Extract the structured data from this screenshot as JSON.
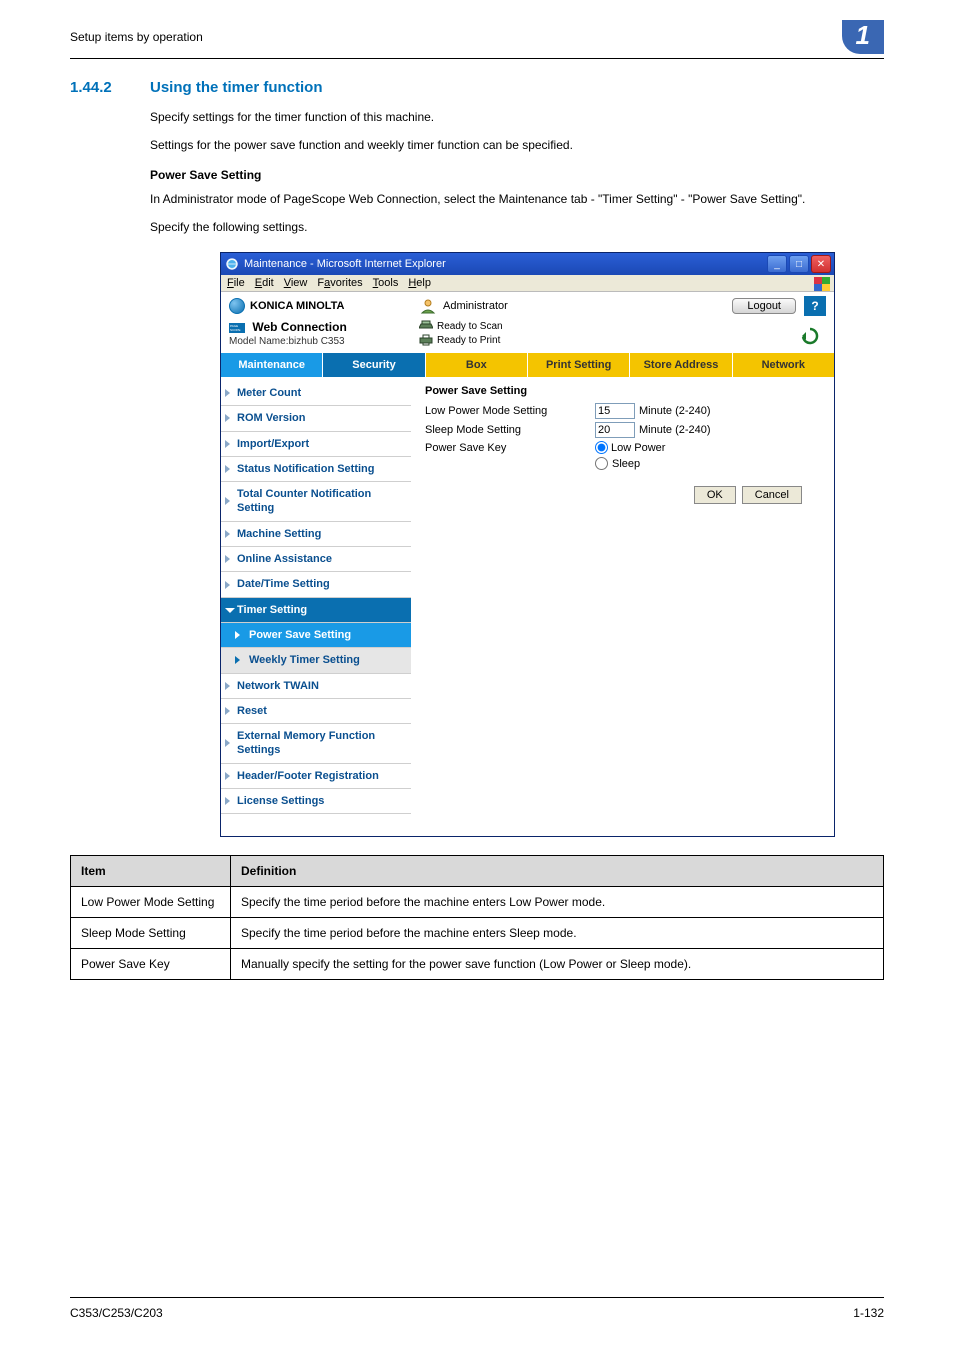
{
  "page": {
    "breadcrumb": "Setup items by operation",
    "badge": "1",
    "footer_left": "C353/C253/C203",
    "footer_right": "1-132"
  },
  "section": {
    "number": "1.44.2",
    "title": "Using the timer function",
    "p1": "Specify settings for the timer function of this machine.",
    "p2": "Settings for the power save function and weekly timer function can be specified.",
    "sub1": "Power Save Setting",
    "p3": "In Administrator mode of PageScope Web Connection, select the Maintenance tab - \"Timer Setting\" - \"Power Save Setting\".",
    "p4": "Specify the following settings."
  },
  "window": {
    "title": "Maintenance - Microsoft Internet Explorer",
    "menu": {
      "file": "File",
      "edit": "Edit",
      "view": "View",
      "fav": "Favorites",
      "tools": "Tools",
      "help": "Help"
    }
  },
  "top": {
    "brand": "KONICA MINOLTA",
    "admin": "Administrator",
    "logout": "Logout",
    "help": "?",
    "pagescope_prefix": "PAGE\nSCOPE",
    "pagescope": "Web Connection",
    "model": "Model Name:bizhub C353",
    "scan": "Ready to Scan",
    "print": "Ready to Print"
  },
  "tabs": {
    "maintenance": "Maintenance",
    "security": "Security",
    "box": "Box",
    "print": "Print Setting",
    "store": "Store Address",
    "network": "Network"
  },
  "sidebar": {
    "meter": "Meter Count",
    "rom": "ROM Version",
    "import": "Import/Export",
    "status": "Status Notification Setting",
    "total": "Total Counter Notification Setting",
    "machine": "Machine Setting",
    "online": "Online Assistance",
    "date": "Date/Time Setting",
    "timer": "Timer Setting",
    "power": "Power Save Setting",
    "weekly": "Weekly Timer Setting",
    "twain": "Network TWAIN",
    "reset": "Reset",
    "external": "External Memory Function Settings",
    "header": "Header/Footer Registration",
    "license": "License Settings"
  },
  "form": {
    "title": "Power Save Setting",
    "low_power_label": "Low Power Mode Setting",
    "low_power_value": "15",
    "sleep_label": "Sleep Mode Setting",
    "sleep_value": "20",
    "minute": "Minute (2-240)",
    "psk_label": "Power Save Key",
    "low_power_radio": "Low Power",
    "sleep_radio": "Sleep",
    "ok": "OK",
    "cancel": "Cancel"
  },
  "table": {
    "h1": "Item",
    "h2": "Definition",
    "r1c1": "Low Power Mode Setting",
    "r1c2": "Specify the time period before the machine enters Low Power mode.",
    "r2c1": "Sleep Mode Setting",
    "r2c2": "Specify the time period before the machine enters Sleep mode.",
    "r3c1": "Power Save Key",
    "r3c2": "Manually specify the setting for the power save function (Low Power or Sleep mode)."
  }
}
